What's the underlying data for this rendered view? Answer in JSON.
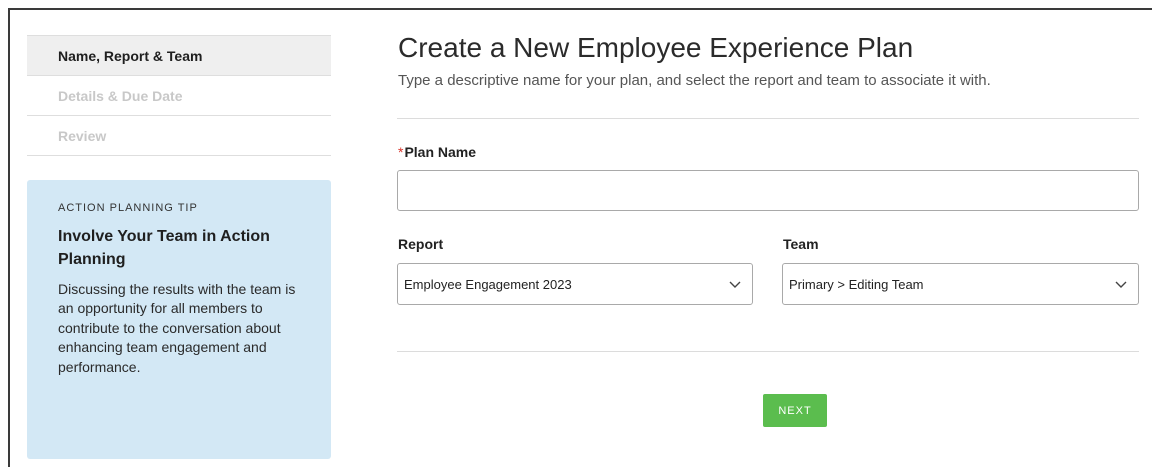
{
  "steps": [
    {
      "label": "Name, Report & Team",
      "active": true
    },
    {
      "label": "Details & Due Date",
      "active": false
    },
    {
      "label": "Review",
      "active": false
    }
  ],
  "tip": {
    "kicker": "ACTION PLANNING TIP",
    "title": "Involve Your Team in Action Planning",
    "body": "Discussing the results with the team is an opportunity for all members to contribute to the conversation about enhancing team engagement and performance."
  },
  "header": {
    "title": "Create a New Employee Experience Plan",
    "subtitle": "Type a descriptive name for your plan, and select the report and team to associate it with."
  },
  "form": {
    "plan_name": {
      "required_marker": "*",
      "label": "Plan Name",
      "value": ""
    },
    "report": {
      "label": "Report",
      "selected": "Employee Engagement 2023"
    },
    "team": {
      "label": "Team",
      "selected": "Primary > Editing Team"
    },
    "next_label": "NEXT"
  },
  "colors": {
    "accent_green": "#5bbd4e",
    "tip_background": "#d3e8f5",
    "required_red": "#d9342b"
  }
}
